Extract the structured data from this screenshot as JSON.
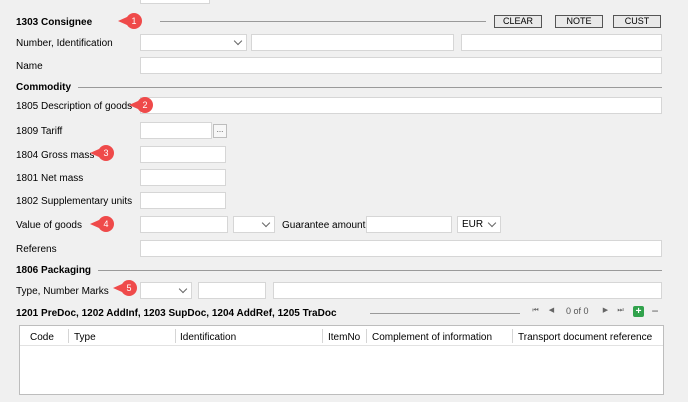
{
  "consignee": {
    "title": "1303 Consignee",
    "buttons": {
      "clear": "CLEAR",
      "note": "NOTE",
      "cust": "CUST"
    },
    "labels": {
      "number_identification": "Number, Identification",
      "name": "Name"
    }
  },
  "commodity": {
    "title": "Commodity",
    "labels": {
      "description": "1805 Description of goods",
      "tariff": "1809 Tariff",
      "gross_mass": "1804 Gross mass",
      "net_mass": "1801 Net mass",
      "supplementary_units": "1802 Supplementary units",
      "value_of_goods": "Value of goods",
      "guarantee_amount": "Guarantee amount",
      "referens": "Referens"
    },
    "currency": "EUR",
    "tariff_button": "..."
  },
  "packaging": {
    "title": "1806 Packaging",
    "labels": {
      "type_number_marks": "Type, Number Marks"
    }
  },
  "documents": {
    "title": "1201 PreDoc, 1202 AddInf,  1203 SupDoc, 1204 AddRef, 1205 TraDoc",
    "pager": "0 of 0",
    "nav": {
      "first": "⏮",
      "prev": "◀",
      "next": "▶",
      "last": "⏭",
      "add": "+",
      "remove": "−"
    },
    "columns": [
      "Code",
      "Type",
      "Identification",
      "ItemNo",
      "Complement of information",
      "Transport document reference"
    ]
  },
  "badges": [
    "1",
    "2",
    "3",
    "4",
    "5"
  ],
  "colors": {
    "badge": "#ef4a4a",
    "add_button": "#31a24c"
  },
  "icons": {
    "dropdown": "chevron-down-icon",
    "first": "first-page-icon",
    "prev": "previous-page-icon",
    "next": "next-page-icon",
    "last": "last-page-icon",
    "add": "plus-icon",
    "remove": "minus-icon"
  }
}
